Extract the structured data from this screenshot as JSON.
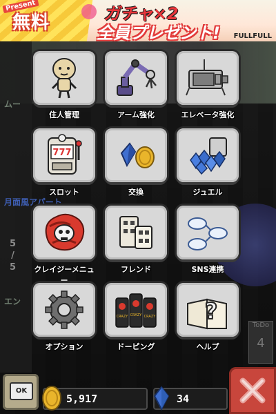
{
  "banner": {
    "present": "Present",
    "free": "無料",
    "gacha": "ガチャ×2",
    "all_present": "全員プレゼント!",
    "brand": "FULLFULL"
  },
  "background": {
    "side_label_1": "ムー",
    "side_label_2": "月面風アパート",
    "side_label_3": "エン",
    "ratio_top": "5",
    "ratio_bottom": "5",
    "todo_label": "ToDo",
    "todo_count": "4"
  },
  "menu": {
    "items": [
      {
        "id": "resident",
        "label": "住人管理",
        "icon": "resident-icon"
      },
      {
        "id": "arm",
        "label": "アーム強化",
        "icon": "robot-arm-icon"
      },
      {
        "id": "elevator",
        "label": "エレベータ強化",
        "icon": "elevator-icon"
      },
      {
        "id": "slot",
        "label": "スロット",
        "icon": "slot-machine-icon"
      },
      {
        "id": "exchange",
        "label": "交換",
        "icon": "exchange-icon"
      },
      {
        "id": "jewel",
        "label": "ジュエル",
        "icon": "jewel-icon"
      },
      {
        "id": "crazy_menu",
        "label": "クレイジーメニュー",
        "icon": "crazy-skull-icon"
      },
      {
        "id": "friend",
        "label": "フレンド",
        "icon": "friend-buildings-icon"
      },
      {
        "id": "sns",
        "label": "SNS連携",
        "icon": "sns-link-icon"
      },
      {
        "id": "option",
        "label": "オプション",
        "icon": "gear-icon"
      },
      {
        "id": "doping",
        "label": "ドーピング",
        "icon": "crazy-cans-icon"
      },
      {
        "id": "help",
        "label": "ヘルプ",
        "icon": "help-book-icon"
      }
    ]
  },
  "cans_text": "CRAZY",
  "ok_label": "OK",
  "currency": {
    "coins": "5,917",
    "jewels": "34"
  },
  "colors": {
    "tile_bg": "#d8d8d8",
    "close_red": "#c8463c",
    "coin_gold": "#e9b52b",
    "jewel_blue": "#2f5fb6"
  }
}
